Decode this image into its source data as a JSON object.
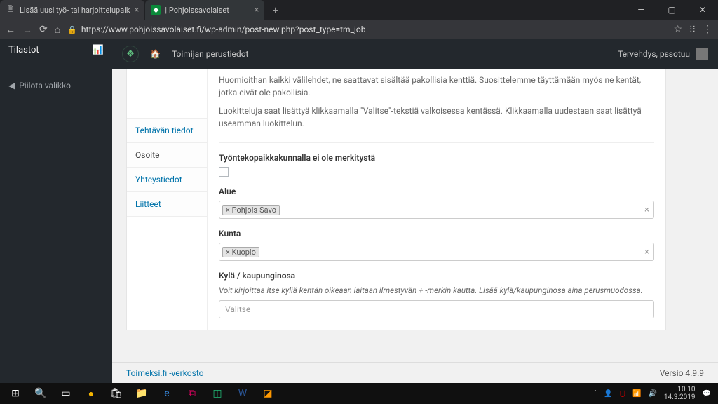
{
  "browser": {
    "tabs": [
      {
        "title": "Lisää uusi työ- tai harjoittelupaik"
      },
      {
        "title": "| Pohjoissavolaiset"
      }
    ],
    "url": "https://www.pohjoissavolaiset.fi/wp-admin/post-new.php?post_type=tm_job"
  },
  "sidebar": {
    "stats": "Tilastot",
    "collapse": "Piilota valikko"
  },
  "adminbar": {
    "menu": "Toimijan perustiedot",
    "greeting": "Tervehdys, pssotuu"
  },
  "panel": {
    "tabs": {
      "t1": "Tehtävän tiedot",
      "t2": "Osoite",
      "t3": "Yhteystiedot",
      "t4": "Liitteet"
    },
    "intro1": "Huomioithan kaikki välilehdet, ne saattavat sisältää pakollisia kenttiä. Suosittelemme täyttämään myös ne kentät, jotka eivät ole pakollisia.",
    "intro2": "Luokitteluja saat lisättyä klikkaamalla \"Valitse\"-tekstiä valkoisessa kentässä. Klikkaamalla uudestaan saat lisättyä useamman luokittelun.",
    "nolocation_label": "Työntekopaikkakunnalla ei ole merkitystä",
    "alue_label": "Alue",
    "alue_value": "× Pohjois-Savo",
    "kunta_label": "Kunta",
    "kunta_value": "× Kuopio",
    "kyla_label": "Kylä / kaupunginosa",
    "kyla_hint": "Voit kirjoittaa itse kyliä kentän oikeaan laitaan ilmestyvän + -merkin kautta. Lisää kylä/kaupunginosa aina perusmuodossa.",
    "kyla_placeholder": "Valitse"
  },
  "footer": {
    "left": "Toimeksi.fi -verkosto",
    "right": "Versio 4.9.9"
  },
  "taskbar": {
    "time": "10.10",
    "date": "14.3.2019"
  }
}
